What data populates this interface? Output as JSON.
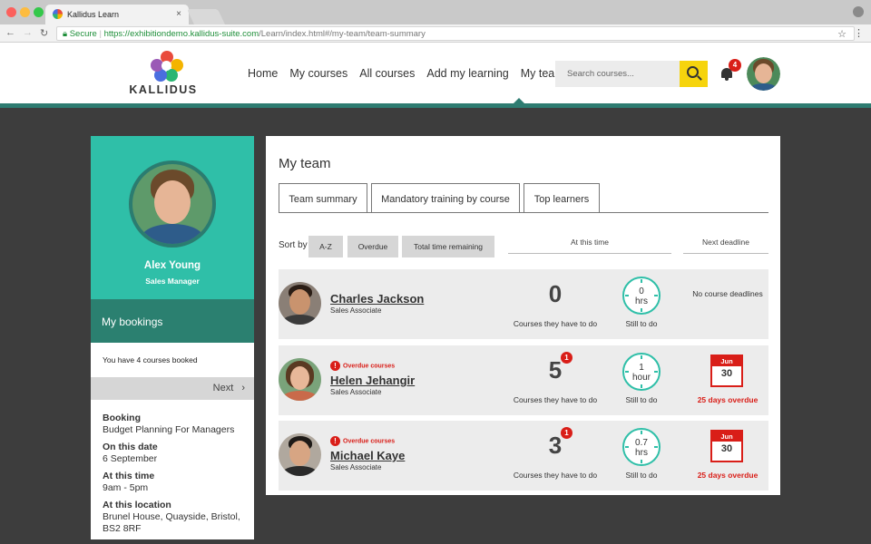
{
  "browser": {
    "tab_title": "Kallidus Learn",
    "tab_close": "×",
    "secure_label": "Secure",
    "url_host": "https://exhibitiondemo.kallidus-suite.com",
    "url_path": "/Learn/index.html#/my-team/team-summary"
  },
  "header": {
    "logo_text": "KALLIDUS",
    "nav": [
      "Home",
      "My courses",
      "All courses",
      "Add my learning",
      "My team"
    ],
    "search_placeholder": "Search courses...",
    "notification_count": "4"
  },
  "profile": {
    "name": "Alex Young",
    "role": "Sales Manager"
  },
  "bookings": {
    "title": "My bookings",
    "count_text": "You have 4 courses booked",
    "next_label": "Next",
    "details": [
      {
        "label": "Booking",
        "value": "Budget Planning For Managers"
      },
      {
        "label": "On this date",
        "value": "6 September"
      },
      {
        "label": "At this time",
        "value": "9am - 5pm"
      },
      {
        "label": "At this location",
        "value": "Brunel House, Quayside, Bristol, BS2 8RF"
      }
    ]
  },
  "main": {
    "title": "My team",
    "tabs": [
      "Team summary",
      "Mandatory training by course",
      "Top learners"
    ],
    "sort_label": "Sort by",
    "sort_options": [
      "A-Z",
      "Overdue",
      "Total time remaining"
    ],
    "col_at_this_time": "At this time",
    "col_next_deadline": "Next deadline",
    "courses_caption": "Courses they have to do",
    "still_caption": "Still to do",
    "members": [
      {
        "name": "Charles Jackson",
        "role": "Sales Associate",
        "overdue_flag": "",
        "courses": "0",
        "badge": "",
        "time_value": "0",
        "time_unit": "hrs",
        "deadline_text": "No course deadlines",
        "deadline_month": "",
        "deadline_day": "",
        "overdue_text": ""
      },
      {
        "name": "Helen Jehangir",
        "role": "Sales Associate",
        "overdue_flag": "Overdue courses",
        "courses": "5",
        "badge": "1",
        "time_value": "1",
        "time_unit": "hour",
        "deadline_text": "",
        "deadline_month": "Jun",
        "deadline_day": "30",
        "overdue_text": "25 days overdue"
      },
      {
        "name": "Michael Kaye",
        "role": "Sales Associate",
        "overdue_flag": "Overdue courses",
        "courses": "3",
        "badge": "1",
        "time_value": "0.7",
        "time_unit": "hrs",
        "deadline_text": "",
        "deadline_month": "Jun",
        "deadline_day": "30",
        "overdue_text": "25 days overdue"
      }
    ]
  },
  "colors": {
    "teal": "#2fbfa8",
    "dark_teal": "#2b8070",
    "alert_red": "#d91e18",
    "search_yellow": "#f6d40d"
  }
}
